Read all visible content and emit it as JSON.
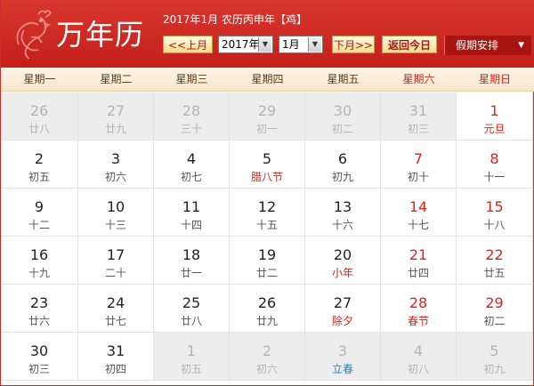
{
  "header": {
    "title": "万年历",
    "lunar_info": "2017年1月 农历丙申年【鸡】",
    "prev_label": "<<上月",
    "year_value": "2017年",
    "month_value": "1月",
    "next_label": "下月>>",
    "today_label": "返回今日",
    "holiday_label": "假期安排"
  },
  "weekdays": [
    "星期一",
    "星期二",
    "星期三",
    "星期四",
    "星期五",
    "星期六",
    "星期日"
  ],
  "weeks": [
    [
      {
        "d": "26",
        "s": "廿八",
        "t": "other"
      },
      {
        "d": "27",
        "s": "廿九",
        "t": "other"
      },
      {
        "d": "28",
        "s": "三十",
        "t": "other"
      },
      {
        "d": "29",
        "s": "初一",
        "t": "other"
      },
      {
        "d": "30",
        "s": "初二",
        "t": "other"
      },
      {
        "d": "31",
        "s": "初三",
        "t": "other"
      },
      {
        "d": "1",
        "s": "元旦",
        "t": "first"
      }
    ],
    [
      {
        "d": "2",
        "s": "初五",
        "t": ""
      },
      {
        "d": "3",
        "s": "初六",
        "t": ""
      },
      {
        "d": "4",
        "s": "初七",
        "t": ""
      },
      {
        "d": "5",
        "s": "腊八节",
        "t": "fest"
      },
      {
        "d": "6",
        "s": "初九",
        "t": ""
      },
      {
        "d": "7",
        "s": "初十",
        "t": "wkend"
      },
      {
        "d": "8",
        "s": "十一",
        "t": "wkend"
      }
    ],
    [
      {
        "d": "9",
        "s": "十二",
        "t": ""
      },
      {
        "d": "10",
        "s": "十三",
        "t": ""
      },
      {
        "d": "11",
        "s": "十四",
        "t": ""
      },
      {
        "d": "12",
        "s": "十五",
        "t": ""
      },
      {
        "d": "13",
        "s": "十六",
        "t": ""
      },
      {
        "d": "14",
        "s": "十七",
        "t": "wkend"
      },
      {
        "d": "15",
        "s": "十八",
        "t": "wkend"
      }
    ],
    [
      {
        "d": "16",
        "s": "十九",
        "t": ""
      },
      {
        "d": "17",
        "s": "二十",
        "t": ""
      },
      {
        "d": "18",
        "s": "廿一",
        "t": ""
      },
      {
        "d": "19",
        "s": "廿二",
        "t": ""
      },
      {
        "d": "20",
        "s": "小年",
        "t": "fest"
      },
      {
        "d": "21",
        "s": "廿四",
        "t": "wkend"
      },
      {
        "d": "22",
        "s": "廿五",
        "t": "wkend"
      }
    ],
    [
      {
        "d": "23",
        "s": "廿六",
        "t": ""
      },
      {
        "d": "24",
        "s": "廿七",
        "t": ""
      },
      {
        "d": "25",
        "s": "廿八",
        "t": ""
      },
      {
        "d": "26",
        "s": "廿九",
        "t": ""
      },
      {
        "d": "27",
        "s": "除夕",
        "t": "fest"
      },
      {
        "d": "28",
        "s": "春节",
        "t": "wkend fest"
      },
      {
        "d": "29",
        "s": "初二",
        "t": "wkend"
      }
    ],
    [
      {
        "d": "30",
        "s": "初三",
        "t": ""
      },
      {
        "d": "31",
        "s": "初四",
        "t": ""
      },
      {
        "d": "1",
        "s": "初五",
        "t": "other"
      },
      {
        "d": "2",
        "s": "初六",
        "t": "other"
      },
      {
        "d": "3",
        "s": "立春",
        "t": "other term"
      },
      {
        "d": "4",
        "s": "初八",
        "t": "other"
      },
      {
        "d": "5",
        "s": "初九",
        "t": "other"
      }
    ]
  ],
  "colors": {
    "brand_red": "#c41f1b",
    "weekend_red": "#e0201a",
    "term_blue": "#1a8ad4"
  }
}
